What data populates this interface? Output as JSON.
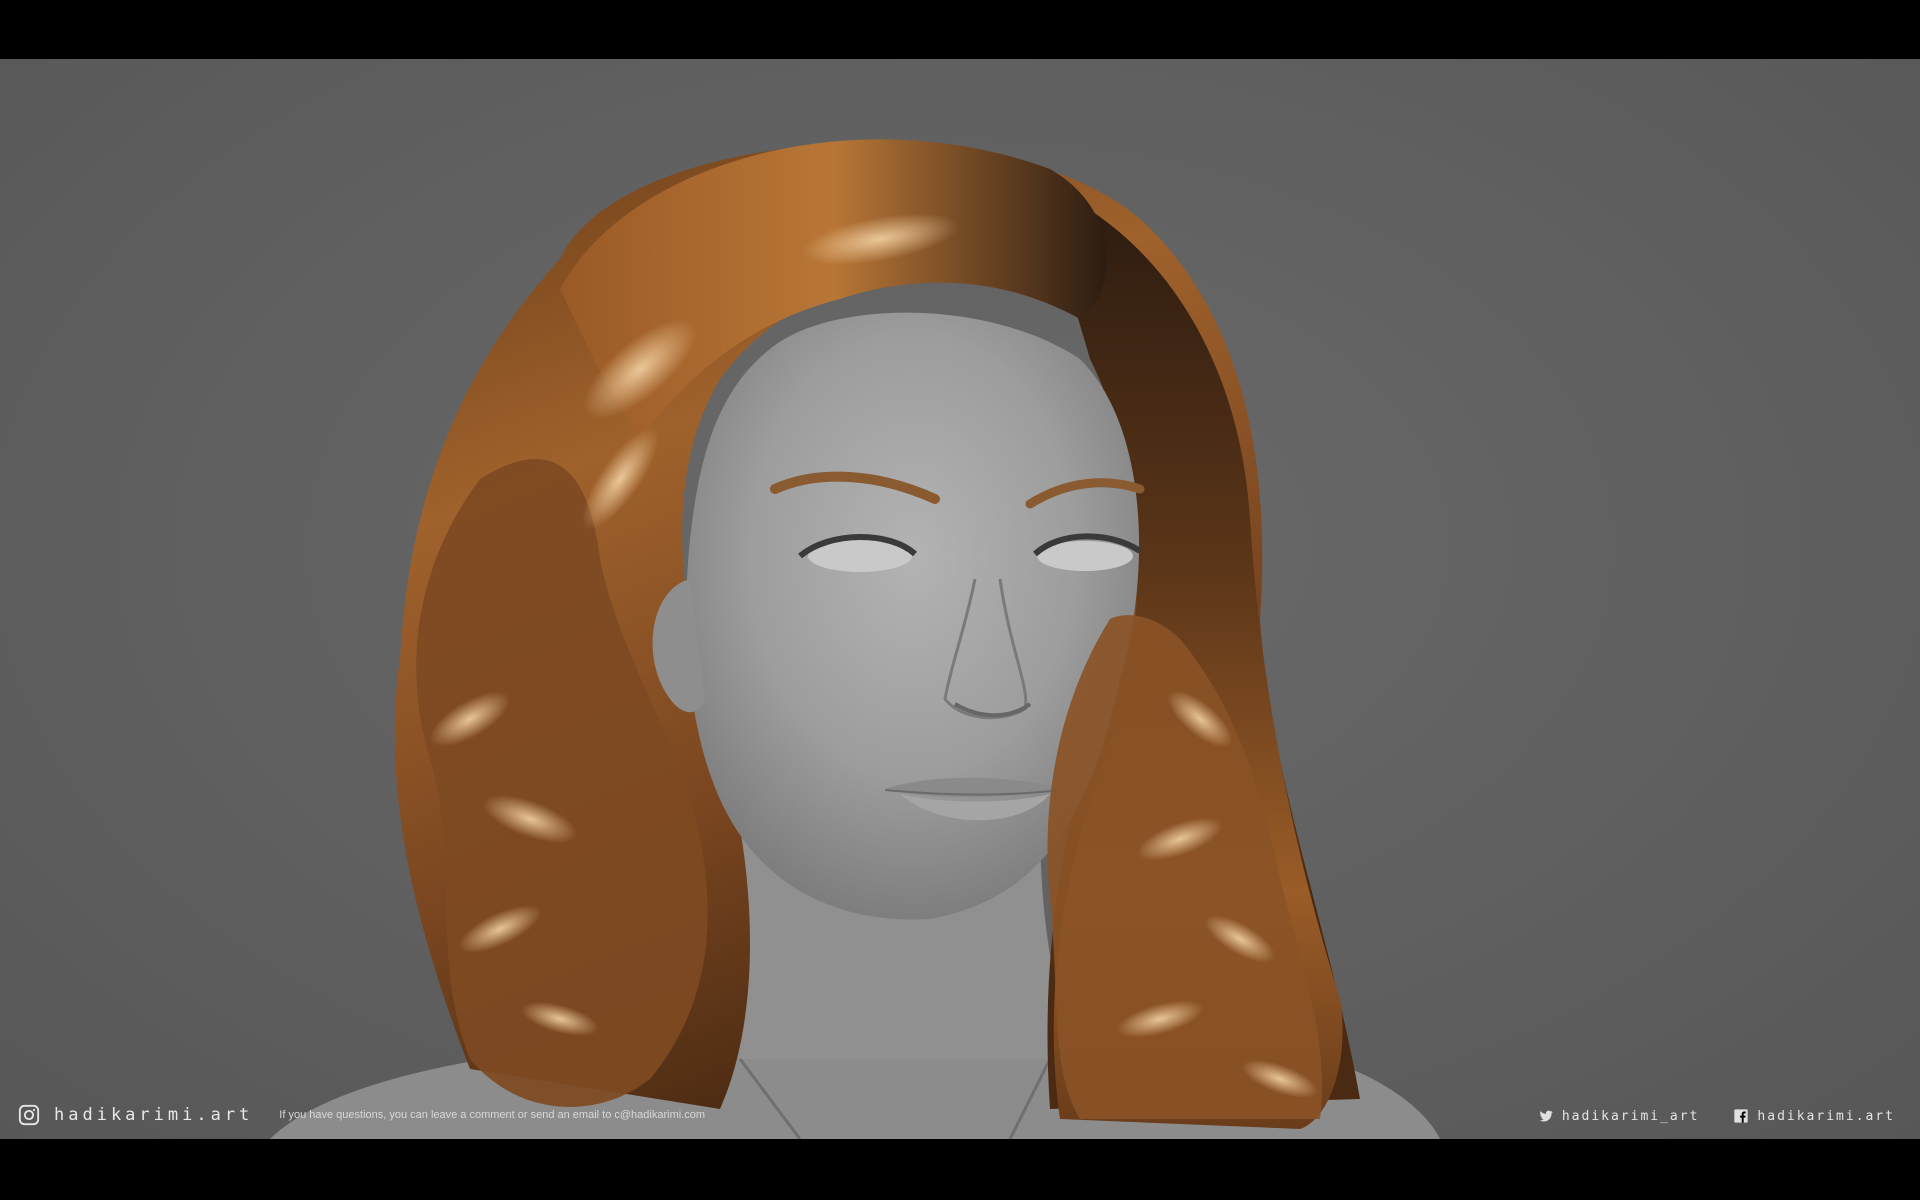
{
  "footer": {
    "instagram_icon": "instagram-icon",
    "instagram_handle": "hadikarimi.art",
    "note": "If you have questions, you can leave a comment or send an email to c@hadikarimi.com",
    "twitter_icon": "twitter-icon",
    "twitter_handle": "hadikarimi_art",
    "facebook_icon": "facebook-icon",
    "facebook_handle": "hadikarimi.art"
  },
  "colors": {
    "background": "#616161",
    "hair": "#8a5426",
    "skin_clay": "#9a9a9a",
    "letterbox": "#000000"
  }
}
